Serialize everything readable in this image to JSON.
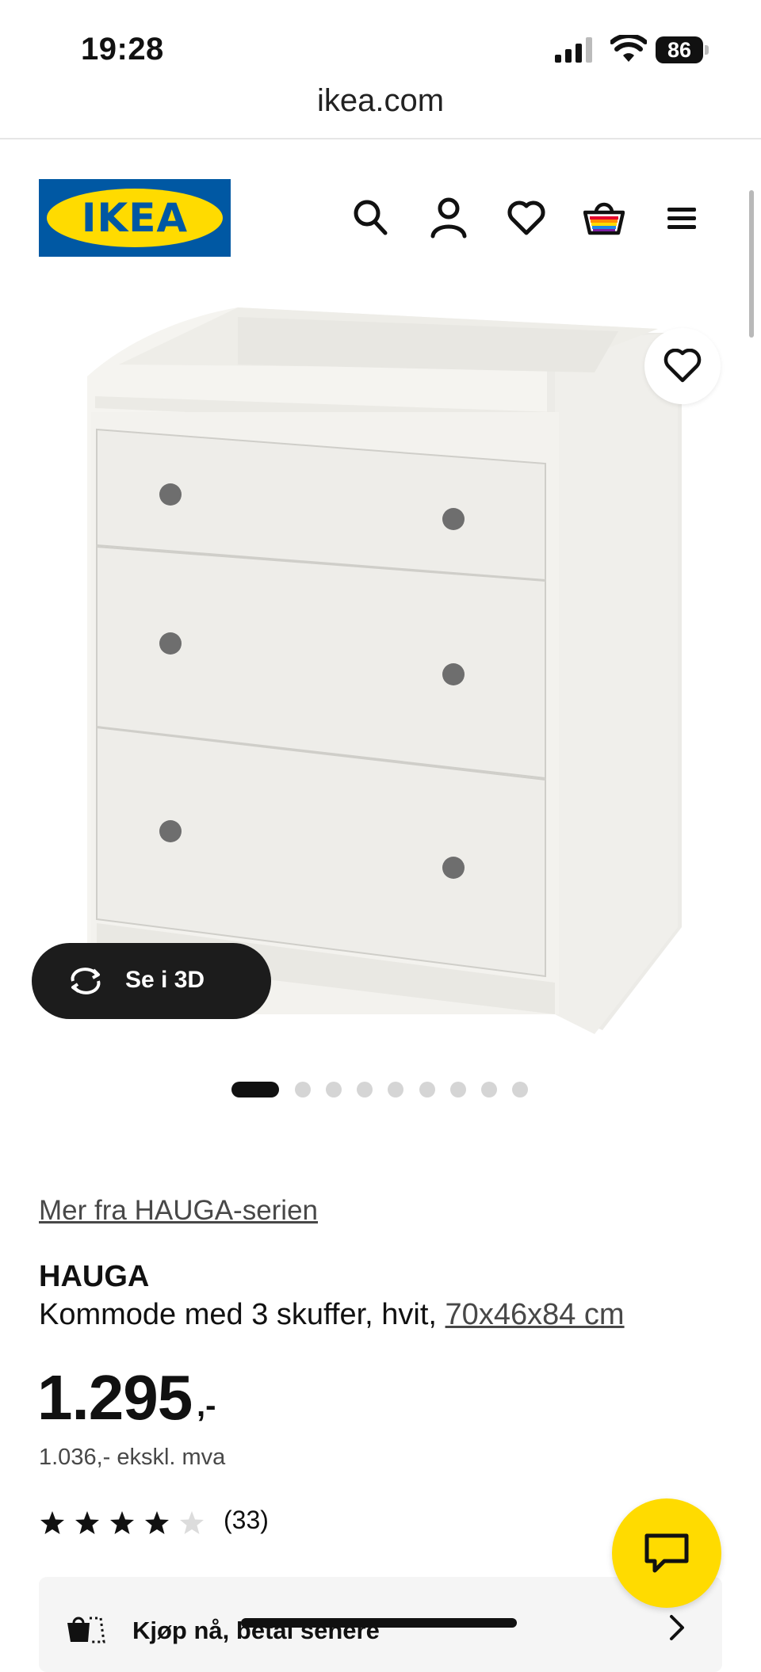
{
  "status_bar": {
    "time": "19:28",
    "battery": "86"
  },
  "browser": {
    "url": "ikea.com"
  },
  "header": {
    "logo_text": "IKEA",
    "icons": [
      "search-icon",
      "user-icon",
      "heart-icon",
      "basket-icon",
      "menu-icon"
    ]
  },
  "gallery": {
    "view_3d_label": "Se i 3D",
    "image_count": 9,
    "active_index": 0
  },
  "product": {
    "series_link": "Mer fra HAUGA-serien",
    "name": "HAUGA",
    "description": "Kommode med 3 skuffer, hvit, ",
    "dimensions": "70x46x84 cm",
    "price": "1.295",
    "price_suffix": ",-",
    "price_ex_vat": "1.036,- ekskl. mva",
    "rating": 4,
    "rating_max": 5,
    "rating_count": "(33)"
  },
  "payment": {
    "label": "Kjøp nå, betal senere"
  },
  "colors": {
    "ikea_blue": "#0058a3",
    "ikea_yellow": "#ffdb00"
  }
}
